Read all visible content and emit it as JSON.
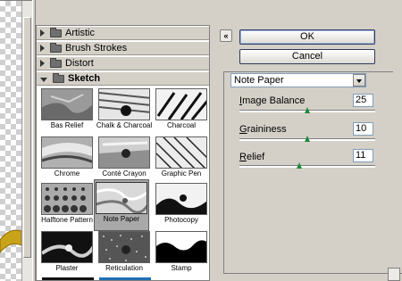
{
  "categories": [
    {
      "label": "Artistic",
      "expanded": false
    },
    {
      "label": "Brush Strokes",
      "expanded": false
    },
    {
      "label": "Distort",
      "expanded": false
    },
    {
      "label": "Sketch",
      "expanded": true
    }
  ],
  "thumbnails": [
    {
      "label": "Bas Relief"
    },
    {
      "label": "Chalk & Charcoal"
    },
    {
      "label": "Charcoal"
    },
    {
      "label": "Chrome"
    },
    {
      "label": "Conté Crayon"
    },
    {
      "label": "Graphic Pen"
    },
    {
      "label": "Halftone Pattern"
    },
    {
      "label": "Note Paper",
      "selected": true
    },
    {
      "label": "Photocopy"
    },
    {
      "label": "Plaster"
    },
    {
      "label": "Reticulation"
    },
    {
      "label": "Stamp"
    }
  ],
  "buttons": {
    "ok": "OK",
    "cancel": "Cancel",
    "collapse": "«"
  },
  "filter_select": {
    "value": "Note Paper"
  },
  "params": {
    "image_balance": {
      "label_pre": "",
      "label_u": "I",
      "label_post": "mage Balance",
      "value": "25",
      "slider_fraction": 0.5
    },
    "graininess": {
      "label_pre": "",
      "label_u": "G",
      "label_post": "raininess",
      "value": "10",
      "slider_fraction": 0.5
    },
    "relief": {
      "label_pre": "",
      "label_u": "R",
      "label_post": "elief",
      "value": "11",
      "slider_fraction": 0.44
    }
  }
}
